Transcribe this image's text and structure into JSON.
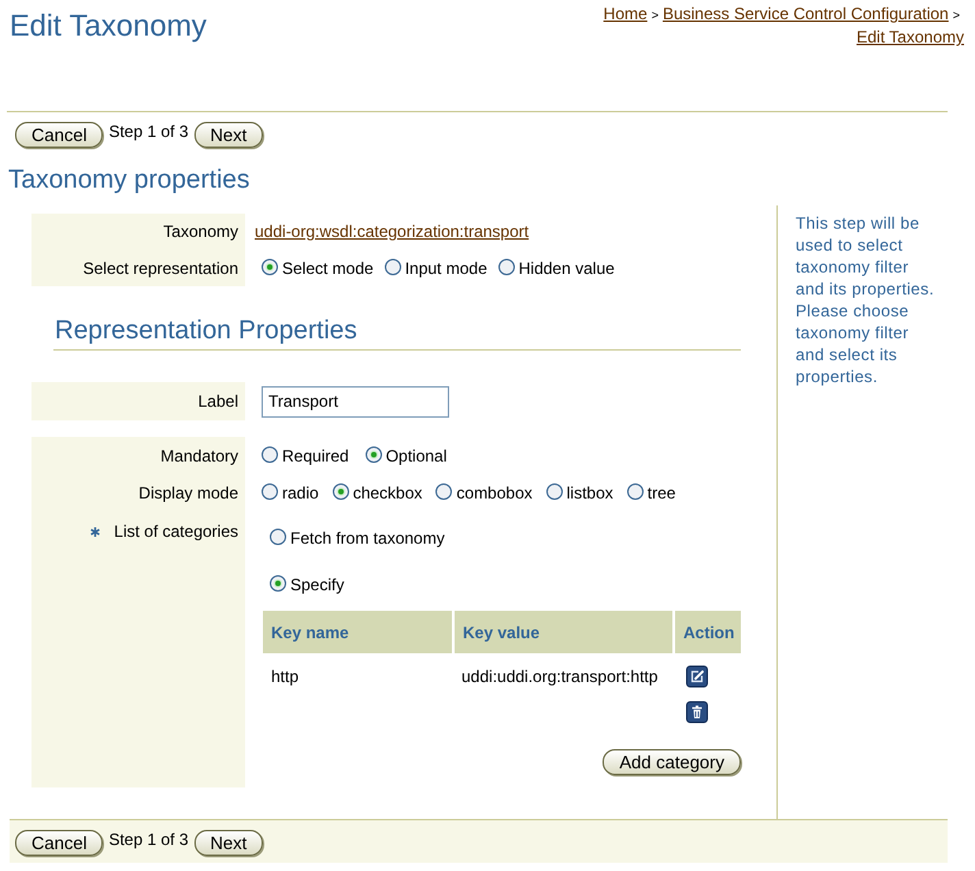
{
  "header": {
    "title": "Edit Taxonomy",
    "breadcrumb": [
      {
        "kind": "link",
        "text": "Home"
      },
      {
        "kind": "separator",
        "text": ">"
      },
      {
        "kind": "link",
        "text": "Business Service Control Configuration"
      },
      {
        "kind": "separator",
        "text": ">"
      },
      {
        "kind": "link",
        "text": "Edit Taxonomy"
      }
    ]
  },
  "top_toolbar": {
    "cancel_button": "Cancel",
    "step_text": "Step 1 of 3",
    "next_button": "Next"
  },
  "taxonomy_properties": {
    "title": "Taxonomy properties",
    "taxonomy": {
      "label": "Taxonomy",
      "value": "uddi-org:wsdl:categorization:transport"
    },
    "select_representation": {
      "label": "Select representation",
      "options": [
        {
          "label": "Select mode",
          "selected": true
        },
        {
          "label": "Input mode",
          "selected": false
        },
        {
          "label": "Hidden value",
          "selected": false
        }
      ]
    }
  },
  "representation_properties": {
    "title": "Representation Properties",
    "label_field": {
      "label": "Label",
      "value": "Transport"
    },
    "mandatory": {
      "label": "Mandatory",
      "options": [
        {
          "label": "Required",
          "selected": false
        },
        {
          "label": "Optional",
          "selected": true
        }
      ]
    },
    "display_mode": {
      "label": "Display mode",
      "options": [
        {
          "label": "radio",
          "selected": false
        },
        {
          "label": "checkbox",
          "selected": true
        },
        {
          "label": "combobox",
          "selected": false
        },
        {
          "label": "listbox",
          "selected": false
        },
        {
          "label": "tree",
          "selected": false
        }
      ]
    },
    "list_of_categories": {
      "label": "List of categories",
      "required": true,
      "options": [
        {
          "label": "Fetch from taxonomy",
          "selected": false
        },
        {
          "label": "Specify",
          "selected": true
        }
      ],
      "table": {
        "columns": [
          "Key name",
          "Key value",
          "Action"
        ],
        "rows": [
          {
            "cells": [
              "http",
              "uddi:uddi.org:transport:http"
            ]
          }
        ]
      },
      "add_button": "Add category"
    }
  },
  "help_text": "This step will be used to select taxonomy filter and its properties. Please choose taxonomy filter and select its properties.",
  "bottom_toolbar": {
    "cancel_button": "Cancel",
    "step_text": "Step 1 of 3",
    "next_button": "Next"
  }
}
